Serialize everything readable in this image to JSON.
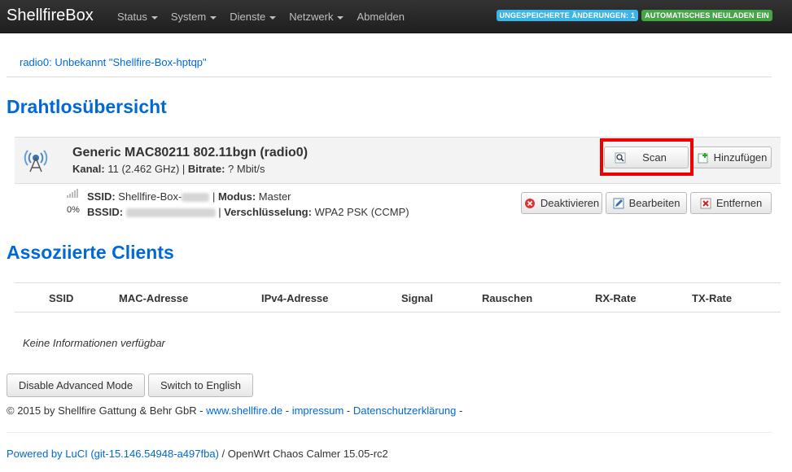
{
  "header": {
    "brand": "ShellfireBox",
    "nav": [
      {
        "label": "Status",
        "dropdown": true
      },
      {
        "label": "System",
        "dropdown": true
      },
      {
        "label": "Dienste",
        "dropdown": true
      },
      {
        "label": "Netzwerk",
        "dropdown": true
      },
      {
        "label": "Abmelden",
        "dropdown": false
      }
    ],
    "badges": [
      {
        "label": "UNGESPEICHERTE ÄNDERUNGEN: 1",
        "color": "#3cb4e6"
      },
      {
        "label": "AUTOMATISCHES NEULADEN EIN",
        "color": "#46a546"
      }
    ]
  },
  "tab": {
    "label": "radio0: Unbekannt \"Shellfire-Box-hptqp\""
  },
  "overview": {
    "heading": "Drahtlosübersicht",
    "device": {
      "title": "Generic MAC80211 802.11bgn (radio0)",
      "channel_label": "Kanal:",
      "channel_value": "11 (2.462 GHz)",
      "bitrate_label": "Bitrate:",
      "bitrate_value": "? Mbit/s"
    },
    "buttons": {
      "scan": "Scan",
      "add": "Hinzufügen"
    },
    "network": {
      "signal_pct": "0%",
      "ssid_label": "SSID:",
      "ssid_value": "Shellfire-Box-",
      "mode_label": "Modus:",
      "mode_value": "Master",
      "bssid_label": "BSSID:",
      "enc_label": "Verschlüsselung:",
      "enc_value": "WPA2 PSK (CCMP)"
    },
    "net_buttons": {
      "disable": "Deaktivieren",
      "edit": "Bearbeiten",
      "remove": "Entfernen"
    }
  },
  "clients": {
    "heading": "Assoziierte Clients",
    "columns": [
      "SSID",
      "MAC-Adresse",
      "IPv4-Adresse",
      "Signal",
      "Rauschen",
      "RX-Rate",
      "TX-Rate"
    ],
    "empty": "Keine Informationen verfügbar"
  },
  "bottom_buttons": {
    "advanced": "Disable Advanced Mode",
    "language": "Switch to English"
  },
  "footer": {
    "copyright": "© 2015 by Shellfire Gattung & Behr GbR -",
    "link1": "www.shellfire.de",
    "sep1": "-",
    "link2": "impressum",
    "sep2": "-",
    "link3": "Datenschutzerklärung",
    "sep3": "-",
    "powered_link": "Powered by LuCI (git-15.146.54948-a497fba)",
    "powered_rest": "/ OpenWrt Chaos Calmer 15.05-rc2"
  }
}
